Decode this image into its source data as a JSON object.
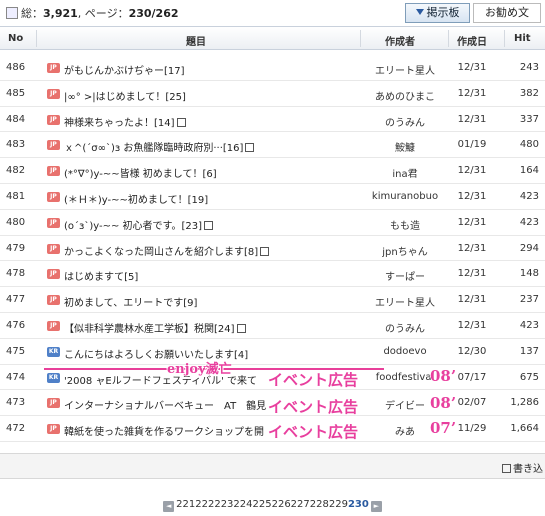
{
  "summary": {
    "total_label": "総：",
    "total": "3,921",
    "page_label": "ページ：",
    "page": "230/262"
  },
  "tabs": {
    "board": "掲示板",
    "recommend": "お勧め文"
  },
  "columns": {
    "no": "No",
    "title": "題目",
    "author": "作成者",
    "date": "作成日",
    "hit": "Hit"
  },
  "rows": [
    {
      "no": "486",
      "badge": "JP",
      "title": "がもじんかぶけぢゃー[17]",
      "memo": false,
      "author": "エリート星人",
      "date": "12/31",
      "hit": "243"
    },
    {
      "no": "485",
      "badge": "JP",
      "title": "|∞° >|はじめまして！[25]",
      "memo": false,
      "author": "あめのひまこ",
      "date": "12/31",
      "hit": "382"
    },
    {
      "no": "484",
      "badge": "JP",
      "title": "神様来ちゃったよ！[14]",
      "memo": true,
      "author": "のうみん",
      "date": "12/31",
      "hit": "337"
    },
    {
      "no": "483",
      "badge": "JP",
      "title": "ｘ^(´σ∞`)з お魚艦隊臨時政府別···[16]",
      "memo": true,
      "author": "鮟鱇",
      "date": "01/19",
      "hit": "480"
    },
    {
      "no": "482",
      "badge": "JP",
      "title": "(*°∇°)y-~~皆様 初めまして！[6]",
      "memo": false,
      "author": "ina君",
      "date": "12/31",
      "hit": "164"
    },
    {
      "no": "481",
      "badge": "JP",
      "title": "(＊Ｈ＊)y-~~初めまして！[19]",
      "memo": false,
      "author": "kimuranobuo",
      "date": "12/31",
      "hit": "423"
    },
    {
      "no": "480",
      "badge": "JP",
      "title": "(o´з`)y-~~ 初心者です。[23]",
      "memo": true,
      "author": "もも造",
      "date": "12/31",
      "hit": "423"
    },
    {
      "no": "479",
      "badge": "JP",
      "title": "かっこよくなった岡山さんを紹介します[8]",
      "memo": true,
      "author": "jpnちゃん",
      "date": "12/31",
      "hit": "294"
    },
    {
      "no": "478",
      "badge": "JP",
      "title": "はじめますて[5]",
      "memo": false,
      "author": "すーぱー",
      "date": "12/31",
      "hit": "148"
    },
    {
      "no": "477",
      "badge": "JP",
      "title": "初めまして、エリートです[9]",
      "memo": false,
      "author": "エリート星人",
      "date": "12/31",
      "hit": "237"
    },
    {
      "no": "476",
      "badge": "JP",
      "title": "【似非科学農林水産工学板】税関[24]",
      "memo": true,
      "author": "のうみん",
      "date": "12/31",
      "hit": "423"
    },
    {
      "no": "475",
      "badge": "KR",
      "title": "こんにちはよろしくお願いいたします[4]",
      "memo": false,
      "author": "dodoevo",
      "date": "12/30",
      "hit": "137"
    },
    {
      "no": "474",
      "badge": "KR",
      "title": "'2008 ャEルフードフェスティバル' で来て",
      "memo": false,
      "author": "foodfestival",
      "date": "07/17",
      "hit": "675"
    },
    {
      "no": "473",
      "badge": "JP",
      "title": "インターナショナルバーベキュー　AT　鶴見",
      "memo": false,
      "author": "デイビー",
      "date": "02/07",
      "hit": "1,286"
    },
    {
      "no": "472",
      "badge": "JP",
      "title": "韓紙を使った雑貨を作るワークショップを開",
      "memo": false,
      "author": "みあ",
      "date": "11/29",
      "hit": "1,664"
    }
  ],
  "annotations": {
    "enjoy": "enjoy滅亡",
    "ad1": "イベント広告",
    "year1": "08’",
    "ad2": "イベント広告",
    "year2": "08’",
    "ad3": "イベント広告",
    "year3": "07’"
  },
  "footer": {
    "write": "書き込"
  },
  "pager": {
    "prev": "◄",
    "next": "►",
    "pages": "221222223224225226227228229",
    "current": "230"
  },
  "colors": {
    "annotation": "#e83f9e",
    "jp_badge": "#e8716d",
    "kr_badge": "#4f80c8",
    "current_page": "#2a5aa0"
  }
}
